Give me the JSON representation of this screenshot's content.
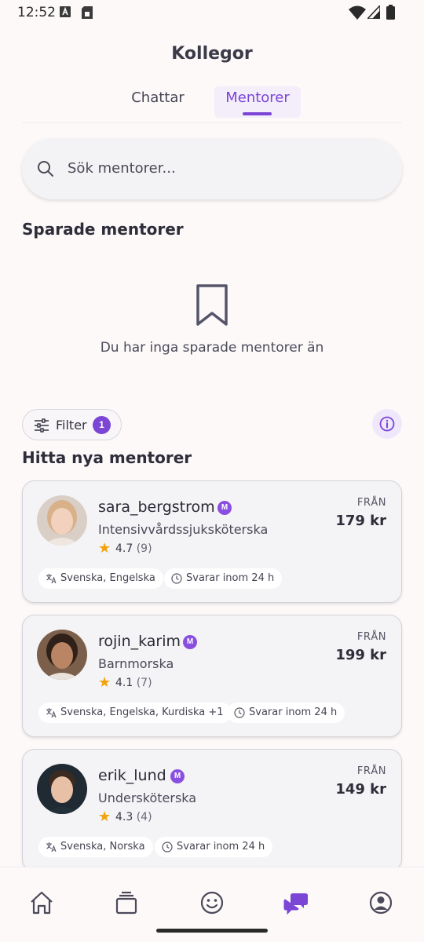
{
  "status_bar": {
    "time": "12:52"
  },
  "header": {
    "title": "Kollegor"
  },
  "tabs": [
    {
      "label": "Chattar",
      "active": false
    },
    {
      "label": "Mentorer",
      "active": true
    }
  ],
  "search": {
    "placeholder": "Sök mentorer..."
  },
  "saved": {
    "title": "Sparade mentorer",
    "empty_text": "Du har inga sparade mentorer än"
  },
  "filter": {
    "label": "Filter",
    "count": "1"
  },
  "find": {
    "title": "Hitta nya mentorer"
  },
  "mentors": [
    {
      "username": "sara_bergstrom",
      "badge": "M",
      "profession": "Intensivvårdssjuksköterska",
      "rating": "4.7",
      "reviews": "(9)",
      "price_label": "FRÅN",
      "price": "179 kr",
      "languages": "Svenska, Engelska",
      "response": "Svarar inom 24 h"
    },
    {
      "username": "rojin_karim",
      "badge": "M",
      "profession": "Barnmorska",
      "rating": "4.1",
      "reviews": "(7)",
      "price_label": "FRÅN",
      "price": "199 kr",
      "languages": "Svenska, Engelska, Kurdiska +1",
      "response": "Svarar inom 24 h"
    },
    {
      "username": "erik_lund",
      "badge": "M",
      "profession": "Undersköterska",
      "rating": "4.3",
      "reviews": "(4)",
      "price_label": "FRÅN",
      "price": "149 kr",
      "languages": "Svenska, Norska",
      "response": "Svarar inom 24 h"
    }
  ],
  "bottom_nav": [
    {
      "icon": "home-icon",
      "active": false
    },
    {
      "icon": "cards-icon",
      "active": false
    },
    {
      "icon": "smiley-icon",
      "active": false
    },
    {
      "icon": "chat-bubbles-icon",
      "active": true
    },
    {
      "icon": "profile-icon",
      "active": false
    }
  ],
  "colors": {
    "accent": "#7b45d6",
    "star": "#f2a20c",
    "background": "#fdf9f9"
  }
}
